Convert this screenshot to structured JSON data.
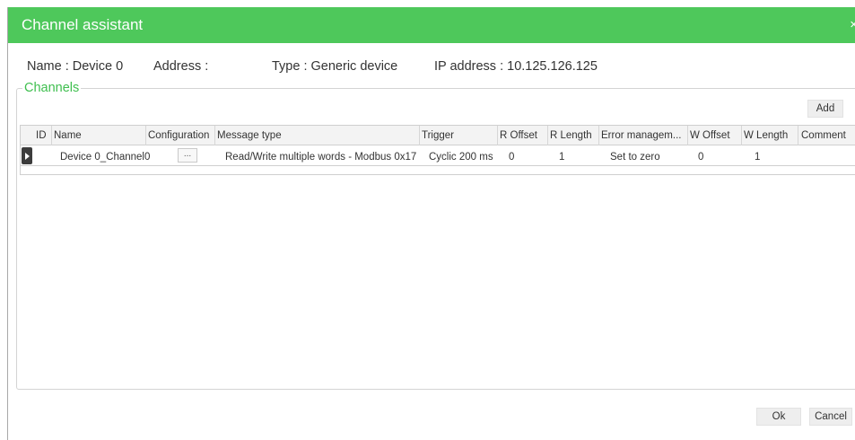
{
  "dialog": {
    "title": "Channel assistant",
    "close_label": "×"
  },
  "info": {
    "name": "Name : Device 0",
    "address": "Address :",
    "type": "Type : Generic device",
    "ip": "IP address : 10.125.126.125"
  },
  "channels": {
    "legend": "Channels",
    "add_label": "Add",
    "columns": [
      "ID",
      "Name",
      "Configuration",
      "Message type",
      "Trigger",
      "R Offset",
      "R Length",
      "Error managem...",
      "W Offset",
      "W Length",
      "Comment"
    ],
    "rows": [
      {
        "id": "",
        "name": "Device 0_Channel0",
        "configuration": "...",
        "message_type": "Read/Write multiple words - Modbus 0x17",
        "trigger": "Cyclic 200 ms",
        "r_offset": "0",
        "r_length": "1",
        "error_management": "Set to zero",
        "w_offset": "0",
        "w_length": "1",
        "comment": ""
      }
    ]
  },
  "footer": {
    "ok_label": "Ok",
    "cancel_label": "Cancel"
  },
  "colors": {
    "titlebar": "#4ec85b",
    "legend_text": "#3fbf4f"
  }
}
